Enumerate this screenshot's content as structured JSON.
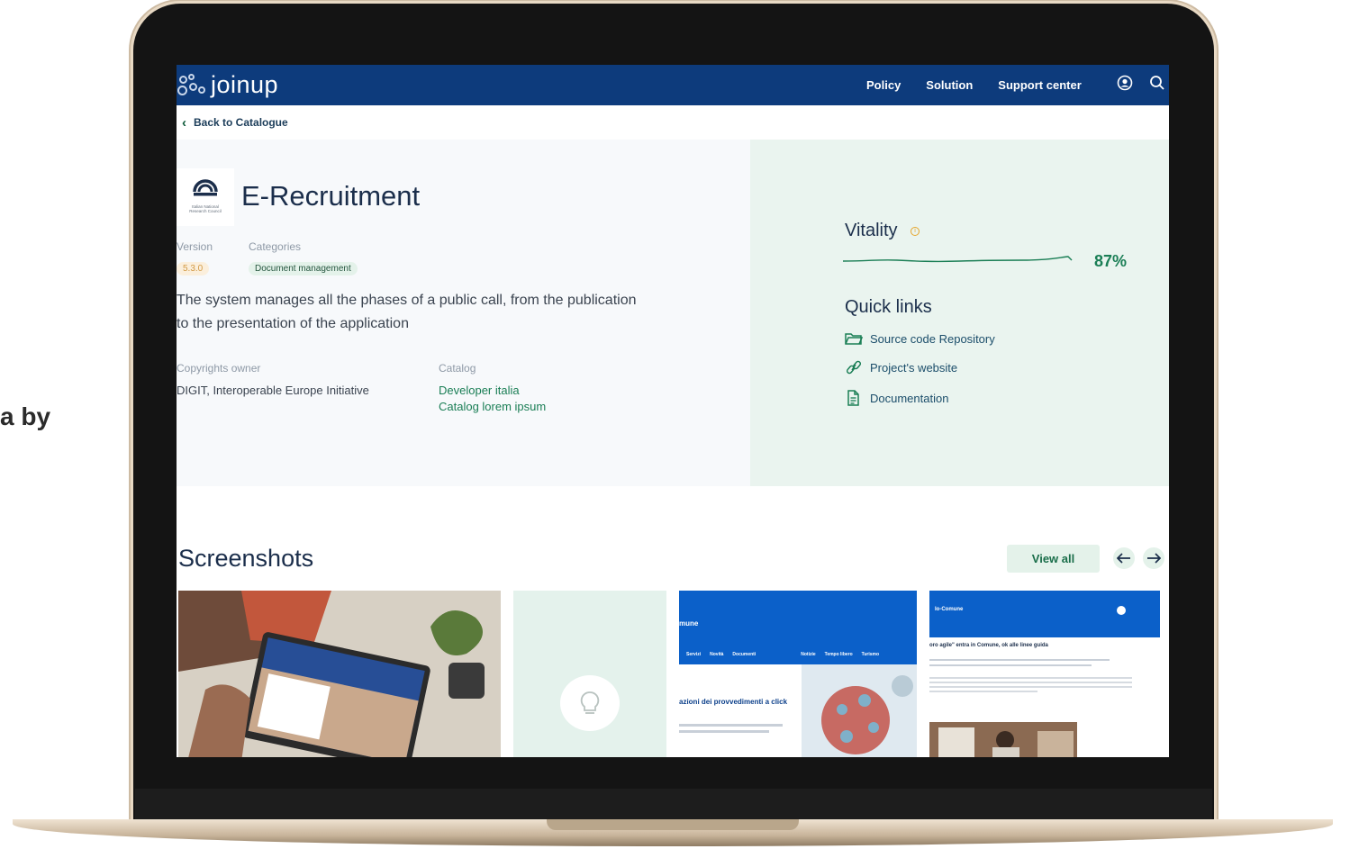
{
  "side_text": "a by",
  "header": {
    "logo_text": "joinup",
    "nav": [
      "Policy",
      "Solution",
      "Support center"
    ],
    "icons": [
      "user-icon",
      "search-icon"
    ]
  },
  "back_link": "Back to Catalogue",
  "solution": {
    "org_logo_caption": "Italian National Research Council",
    "title": "E-Recruitment",
    "version_label": "Version",
    "version_value": "5.3.0",
    "categories_label": "Categories",
    "category_tag": "Document management",
    "description": "The system manages all the phases of a public call, from the publication to the presentation of the application",
    "owner_label": "Copyrights owner",
    "owner_value": "DIGIT, Interoperable Europe Initiative",
    "catalog_label": "Catalog",
    "catalog_links": [
      "Developer italia",
      "Catalog lorem ipsum"
    ]
  },
  "vitality": {
    "title": "Vitality",
    "percent_label": "87%",
    "percent": 87
  },
  "quick_links": {
    "title": "Quick links",
    "items": [
      {
        "label": "Source code Repository",
        "icon": "folder-icon"
      },
      {
        "label": "Project's website",
        "icon": "link-icon"
      },
      {
        "label": "Documentation",
        "icon": "document-icon"
      }
    ]
  },
  "screenshots": {
    "title": "Screenshots",
    "view_all": "View all",
    "thumb3_brand": "mune",
    "thumb3_nav": [
      "Servizi",
      "Novità",
      "Documenti",
      "Notizie",
      "Tempo libero",
      "Turismo"
    ],
    "thumb3_headline": "azioni dei provvedimenti a click",
    "thumb4_brand": "Io-Comune",
    "thumb4_headline": "oro agile\" entra in Comune, ok alle linee guida"
  },
  "colors": {
    "header_bg": "#0d3b7c",
    "accent_green": "#1a7e55",
    "hero_left_bg": "#f7f9fb",
    "hero_right_bg": "#eaf4ef"
  }
}
